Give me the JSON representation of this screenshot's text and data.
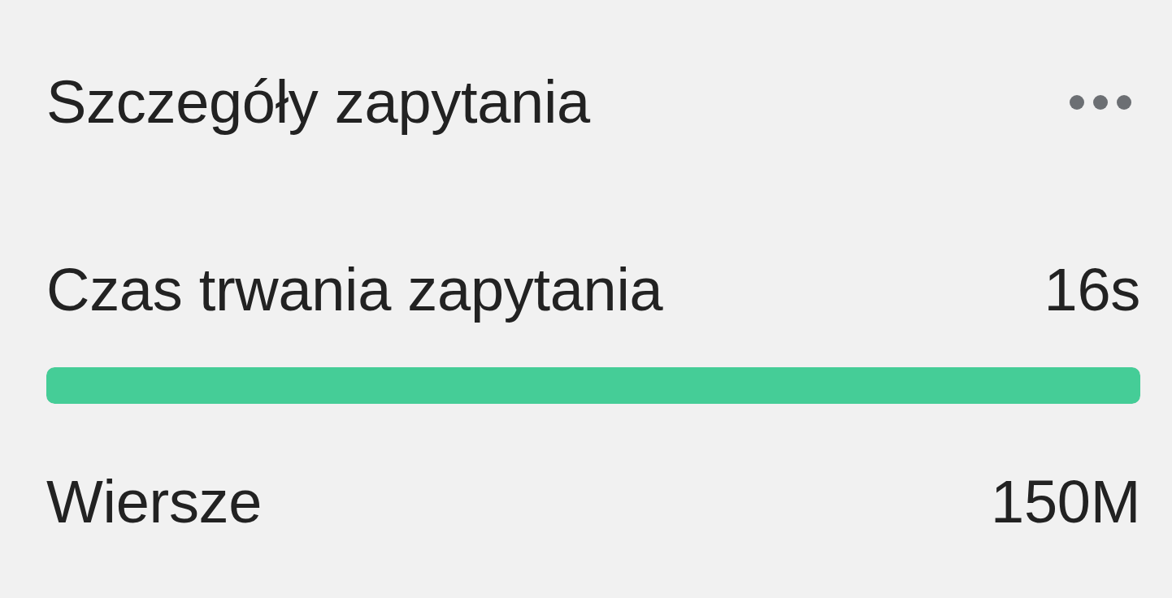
{
  "header": {
    "title": "Szczegóły zapytania"
  },
  "metrics": [
    {
      "kind": "bar",
      "label": "Czas trwania zapytania",
      "value": "16s",
      "level": 1
    },
    {
      "kind": "plain",
      "label": "Wiersze",
      "value": "150M"
    }
  ]
}
